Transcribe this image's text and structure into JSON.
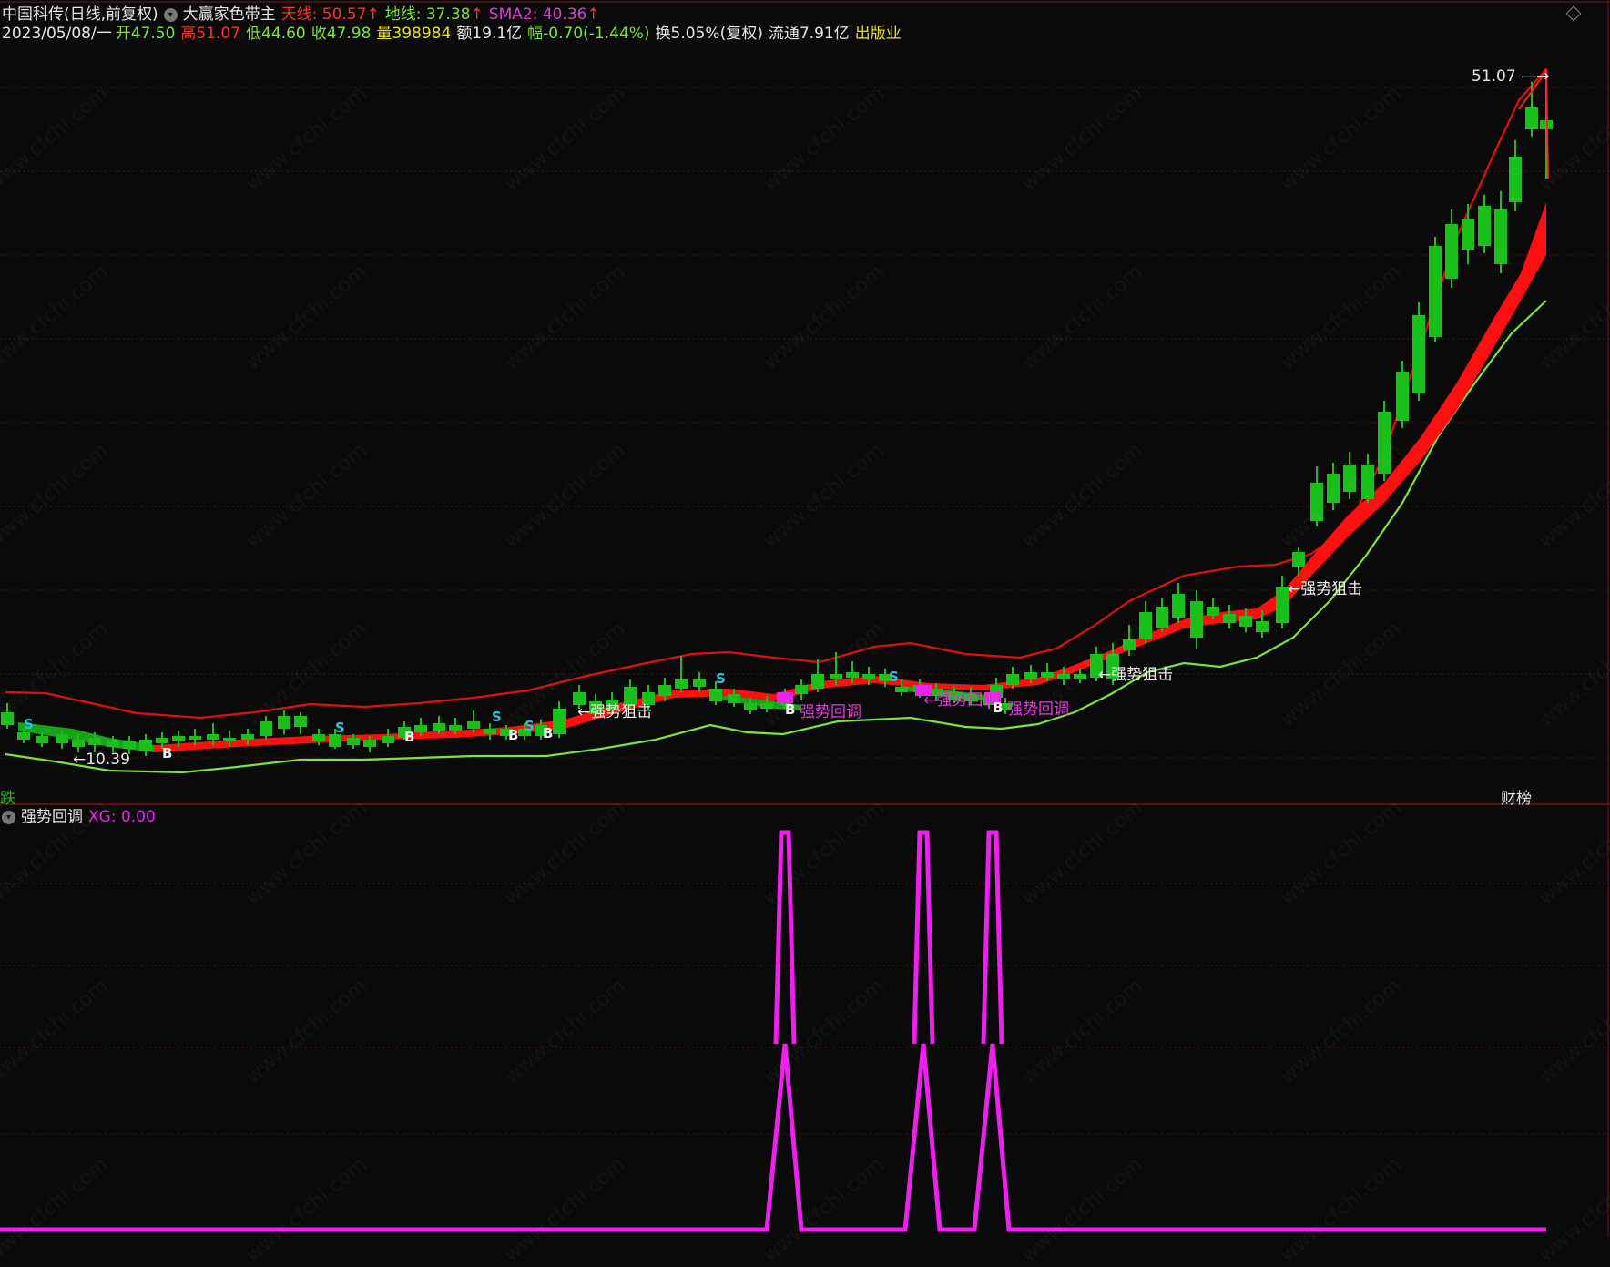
{
  "header": {
    "stock": "中国科传(日线,前复权)",
    "indicator": "大赢家色带主",
    "tianxian": "天线: 50.57",
    "dixian": "地线: 37.38",
    "sma2": "SMA2: 40.36",
    "arrow": "↑"
  },
  "quote": {
    "date": "2023/05/08/一",
    "open": "开47.50",
    "high": "高51.07",
    "low": "低44.60",
    "close": "收47.98",
    "volume": "量398984",
    "amount": "额19.1亿",
    "change": "幅-0.70(-1.44%)",
    "turnover": "换5.05%(复权)",
    "float": "流通7.91亿",
    "sector": "出版业"
  },
  "sub_panel": {
    "title": "强势回调",
    "xg": "XG: 0.00"
  },
  "annotations": {
    "high_mark": "51.07",
    "low_mark": "←10.39",
    "strong_hit": "←强势狙击",
    "pullback": "强势回调",
    "pullback_arrow": "←强势回调",
    "b": "B",
    "s": "S"
  },
  "corner": {
    "left": "跌",
    "right": "财榜"
  },
  "watermark": "www.cfchi.com",
  "colors": {
    "up": "#ffa020",
    "down": "#19c019",
    "upper_band": "#e01010",
    "lower_band": "#7ee23a",
    "ribbon": "#ff1010",
    "xg_line": "#ee20ee",
    "grid": "#5a1010"
  }
}
